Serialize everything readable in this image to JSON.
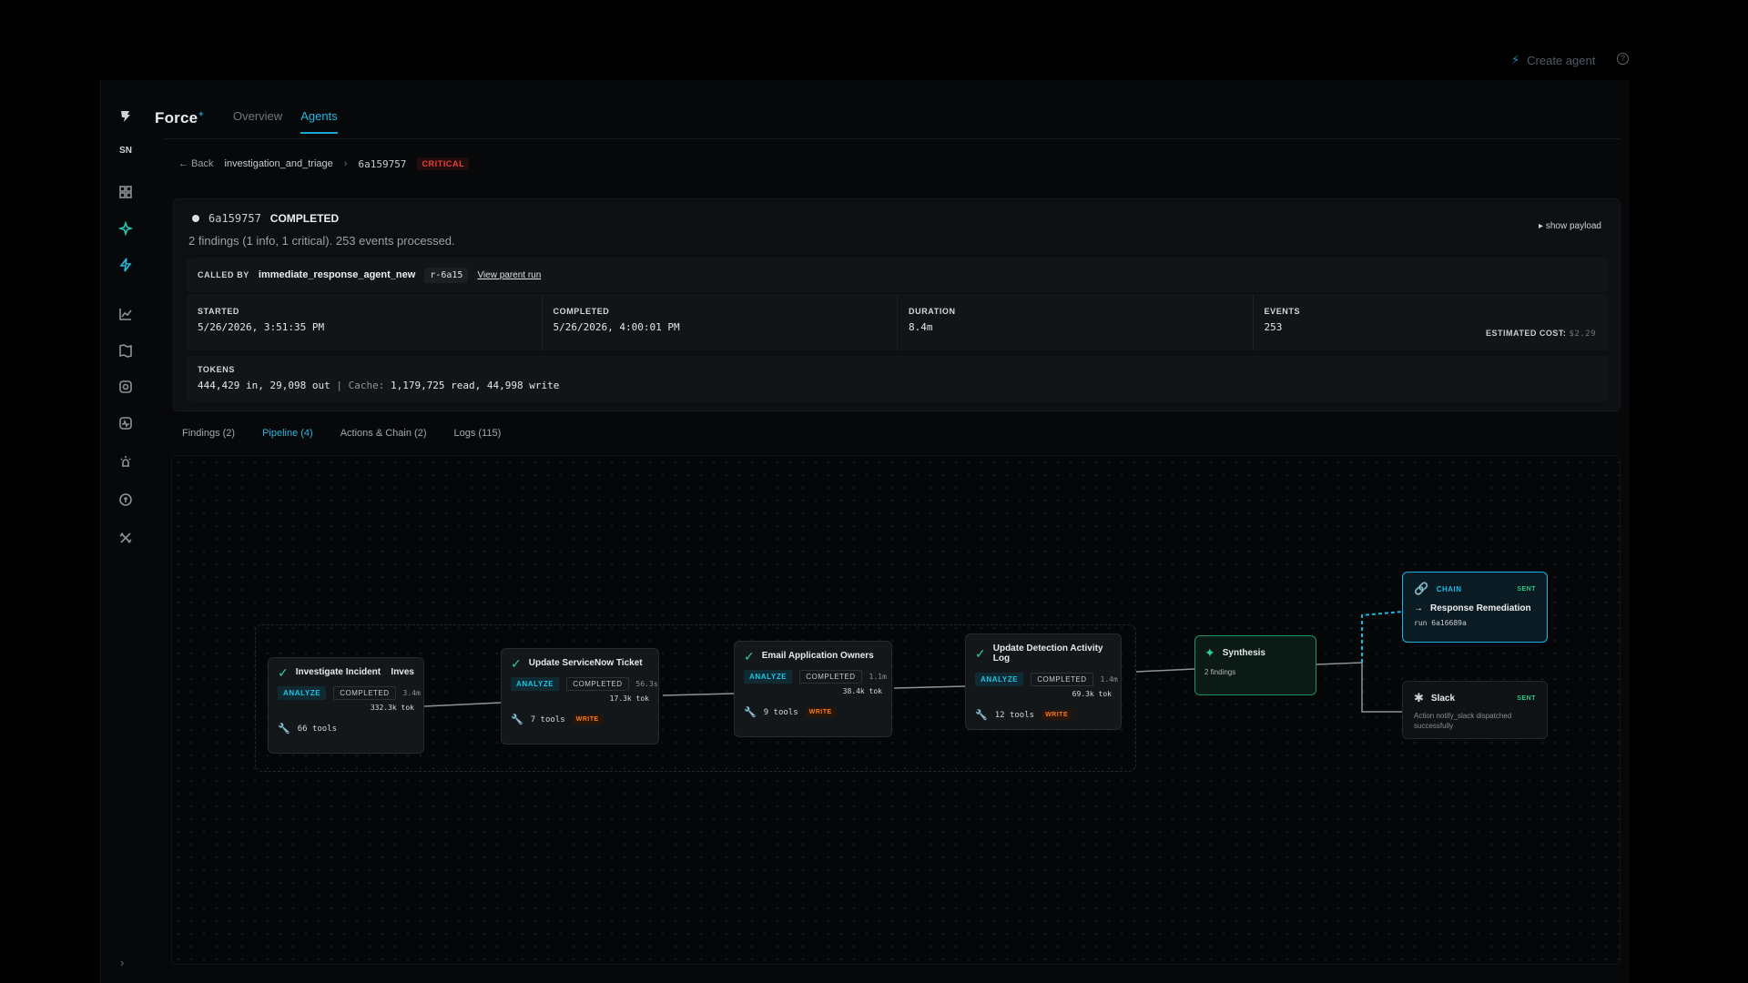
{
  "global": {
    "create_agent_label": "Create agent",
    "help_icon": "?"
  },
  "sidebar": {
    "initials": "SN",
    "expand_icon": "›"
  },
  "brand": {
    "name": "Force",
    "mark": "+"
  },
  "nav": {
    "overview": "Overview",
    "agents": "Agents"
  },
  "breadcrumb": {
    "back": "← Back",
    "workflow": "investigation_and_triage",
    "separator": "›",
    "run_id": "6a159757",
    "severity": "CRITICAL"
  },
  "run": {
    "id": "6a159757",
    "status": "COMPLETED",
    "summary": "2 findings (1 info, 1 critical). 253 events processed.",
    "show_payload": "▸ show payload",
    "called_by_label": "CALLED BY",
    "called_by_agent": "immediate_response_agent_new",
    "parent_run": "r-6a15",
    "view_parent": "View parent run",
    "started_label": "STARTED",
    "started": "5/26/2026, 3:51:35 PM",
    "completed_label": "COMPLETED",
    "completed": "5/26/2026, 4:00:01 PM",
    "duration_label": "DURATION",
    "duration": "8.4m",
    "events_label": "EVENTS",
    "events": "253",
    "cost_label": "ESTIMATED COST:",
    "cost": "$2.29",
    "tokens_label": "TOKENS",
    "tokens_main": "444,429 in, 29,098 out",
    "tokens_sep": "|",
    "cache_label": "Cache:",
    "cache_value": "1,179,725 read, 44,998 write"
  },
  "tabs": {
    "findings": "Findings (2)",
    "pipeline": "Pipeline (4)",
    "actions": "Actions & Chain (2)",
    "logs": "Logs (115)"
  },
  "pipeline": {
    "steps": [
      {
        "title": "Investigate Incident",
        "extra": "Inves",
        "phase": "ANALYZE",
        "status": "COMPLETED",
        "duration": "3.4m",
        "tokens": "332.3k tok",
        "tools": "66 tools",
        "write": ""
      },
      {
        "title": "Update ServiceNow Ticket",
        "extra": "",
        "phase": "ANALYZE",
        "status": "COMPLETED",
        "duration": "56.3s",
        "tokens": "17.3k tok",
        "tools": "7 tools",
        "write": "WRITE"
      },
      {
        "title": "Email Application Owners",
        "extra": "",
        "phase": "ANALYZE",
        "status": "COMPLETED",
        "duration": "1.1m",
        "tokens": "38.4k tok",
        "tools": "9 tools",
        "write": "WRITE"
      },
      {
        "title": "Update Detection Activity Log",
        "extra": "",
        "phase": "ANALYZE",
        "status": "COMPLETED",
        "duration": "1.4m",
        "tokens": "69.3k tok",
        "tools": "12 tools",
        "write": "WRITE"
      }
    ],
    "synthesis": {
      "title": "Synthesis",
      "sub": "2 findings"
    },
    "chain": {
      "label": "CHAIN",
      "status": "SENT",
      "title": "Response Remediation",
      "sub": "run 6a16689a"
    },
    "slack": {
      "title": "Slack",
      "status": "SENT",
      "sub": "Action notify_slack dispatched successfully"
    }
  },
  "colors": {
    "accent": "#1ea7d2",
    "success": "#2ad39e",
    "critical": "#e4413a",
    "write": "#f07b2a"
  }
}
